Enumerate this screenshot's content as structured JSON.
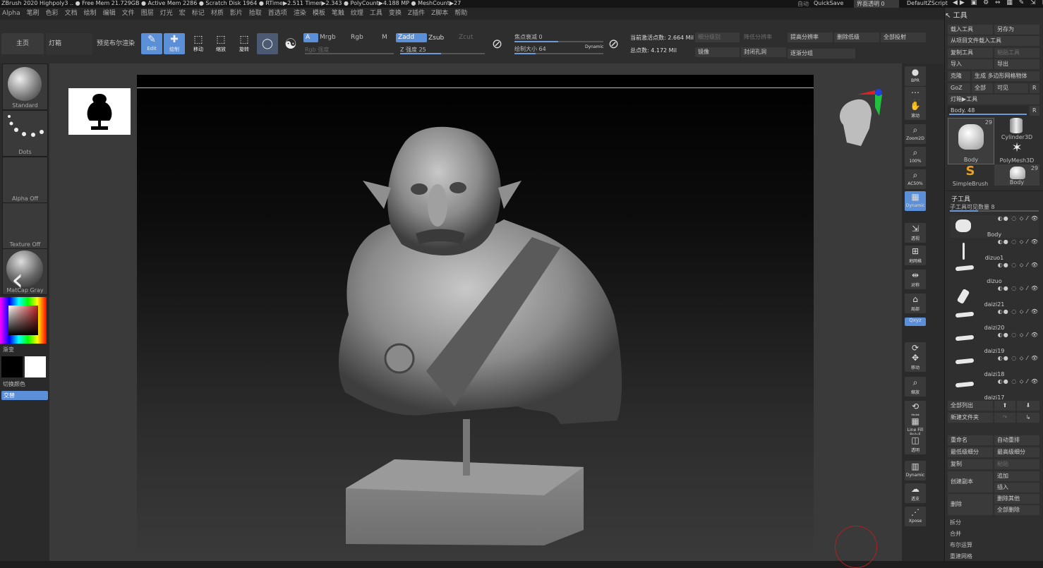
{
  "titlebar": {
    "text": "ZBrush 2020   Highpoly3  .. ● Free Mem 21.729GB ● Active Mem 2286 ● Scratch Disk 1964 ● RTime▶2.511 Timer▶2.343 ● PolyCount▶4.188 MP ● MeshCount▶27",
    "menu_mid": "自动",
    "quicksave": "QuickSave",
    "transparency": "界面透明 0",
    "script": "DefaultZScript"
  },
  "menu": [
    "Alpha",
    "笔刷",
    "色彩",
    "文档",
    "绘制",
    "编辑",
    "文件",
    "图层",
    "灯光",
    "宏",
    "标记",
    "材质",
    "影片",
    "拾取",
    "首选项",
    "渲染",
    "模板",
    "笔触",
    "纹理",
    "工具",
    "变换",
    "Z插件",
    "Z脚本",
    "帮助"
  ],
  "shelf": {
    "home": "主页",
    "lightbox": "灯箱",
    "preview_bool": "预览布尔渲染",
    "edit": "Edit",
    "draw": "绘制",
    "move": "移动",
    "scale": "缩放",
    "rotate": "旋转",
    "a": "A",
    "mrgb": "Mrgb",
    "rgb": "Rgb",
    "m": "M",
    "zadd": "Zadd",
    "zsub": "Zsub",
    "zcut": "Zcut",
    "rgb_intensity": "Rgb 强度",
    "z_intensity": "Z 强度 25",
    "focal_shift": "焦点衰减 0",
    "draw_size": "绘制大小 64",
    "dynamic": "Dynamic",
    "active_points": "当前激活点数: 2.664 Mil",
    "total_points": "总点数: 4.172 Mil",
    "subdiv": "细分级别",
    "lower_res": "降低分辨率",
    "higher_res": "提高分辨率",
    "del_lower": "删除低级",
    "del_all": "全部投射",
    "mirror": "镜像",
    "close_holes": "封闭孔洞",
    "smart_resym": "逐渐分组"
  },
  "left": {
    "brush": "Standard",
    "stroke": "Dots",
    "alpha": "Alpha Off",
    "texture": "Texture Off",
    "material": "MatCap Gray",
    "gradient": "渐变",
    "switch_color": "切换颜色",
    "alternate": "交替"
  },
  "right_icons": [
    "BPR",
    "子像素",
    "滚动",
    "Zoom2D",
    "100%",
    "AC50%",
    "Dynamic",
    "透视",
    "地网格",
    "对称",
    "局部",
    "Qxyz",
    "帧",
    "移动",
    "缩放",
    "旋转",
    "Line Fill PolyF",
    "透明",
    "Dynamic",
    "透支",
    "Xpose"
  ],
  "palette": {
    "title": "工具",
    "load_tool": "载入工具",
    "save_as": "另存为",
    "load_from_project": "从项目文件载入工具",
    "copy_tool": "复制工具",
    "paste_tool": "粘贴工具",
    "import": "导入",
    "export": "导出",
    "clone": "克隆",
    "make_polymesh": "生成 多边形网格物体",
    "goz": "GoZ",
    "all": "全部",
    "visible": "可见",
    "r": "R",
    "lightbox_tools": "灯箱▶工具",
    "body_slider": "Body. 48",
    "tools": [
      {
        "name": "Body",
        "count": "29"
      },
      {
        "name": "Cylinder3D",
        "count": ""
      },
      {
        "name": "PolyMesh3D",
        "count": ""
      },
      {
        "name": "SimpleBrush",
        "count": ""
      },
      {
        "name": "Body",
        "count": "29"
      }
    ],
    "subtool_title": "子工具",
    "visible_count": "子工具可见数量 8",
    "subtools": [
      "Body",
      "dizuo1",
      "dizuo",
      "daizi21",
      "daizi20",
      "daizi19",
      "daizi18",
      "daizi17"
    ],
    "list_all": "全部列出",
    "new_folder": "新建文件夹",
    "rename": "重命名",
    "auto_reorder": "自动重排",
    "lowest_subdiv": "最低级细分",
    "highest_subdiv": "最高级细分",
    "duplicate": "复制",
    "paste": "粘贴",
    "append": "追加",
    "create_copy": "创建副本",
    "insert": "插入",
    "delete": "删除",
    "del_other": "删除其他",
    "del_all": "全部删除",
    "split": "拆分",
    "merge": "合并",
    "boolean": "布尔运算",
    "remesh": "重建网格"
  },
  "colors": {
    "accent": "#5b8fd8",
    "bg": "#1e1e1e"
  }
}
